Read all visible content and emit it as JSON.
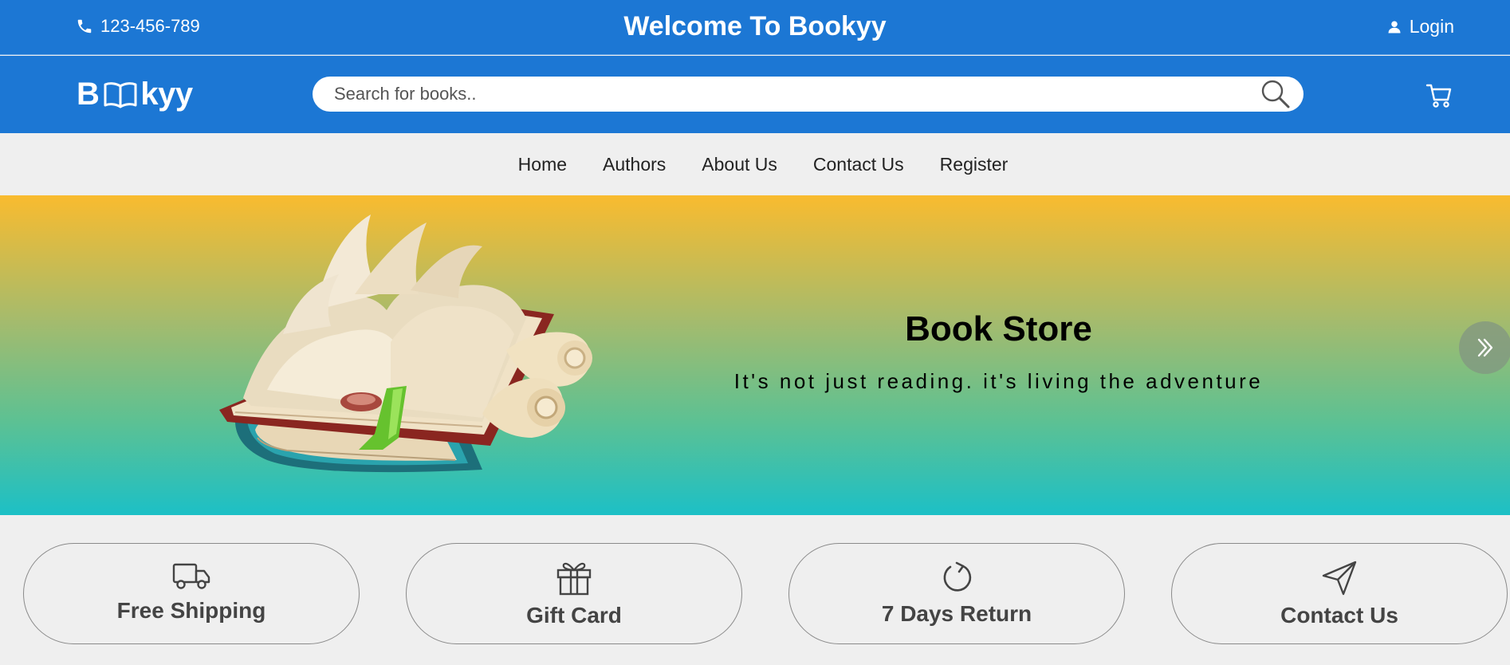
{
  "topbar": {
    "phone": "123-456-789",
    "welcome": "Welcome To Bookyy",
    "login": "Login"
  },
  "header": {
    "logo_left": "B",
    "logo_right": "kyy",
    "search_placeholder": "Search for books.."
  },
  "nav": {
    "items": [
      "Home",
      "Authors",
      "About Us",
      "Contact Us",
      "Register"
    ]
  },
  "hero": {
    "title": "Book Store",
    "tagline": "It's not just reading. it's living the adventure"
  },
  "features": [
    {
      "label": "Free Shipping",
      "icon": "truck-icon"
    },
    {
      "label": "Gift Card",
      "icon": "gift-icon"
    },
    {
      "label": "7 Days Return",
      "icon": "refresh-icon"
    },
    {
      "label": "Contact Us",
      "icon": "send-icon"
    }
  ],
  "colors": {
    "brand_blue": "#1c77d4",
    "hero_top": "#f9bb2f",
    "hero_bottom": "#1cc0c6",
    "page_bg": "#efefef"
  }
}
